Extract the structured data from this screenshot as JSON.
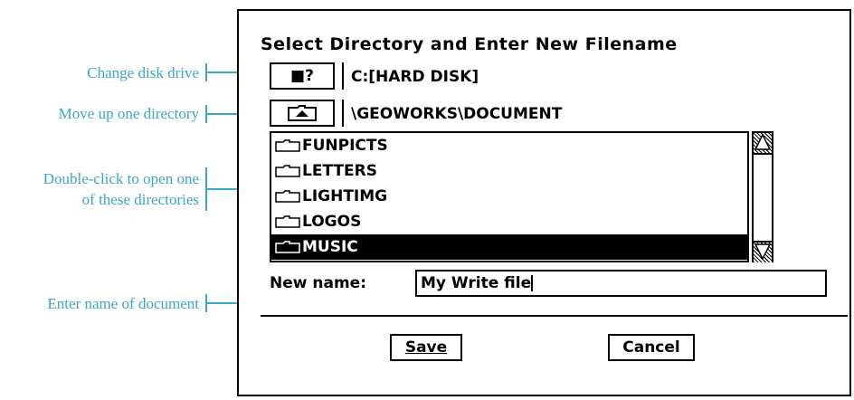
{
  "annotations": {
    "change_drive": "Change disk drive",
    "move_up": "Move up one directory",
    "open_dir_line1": "Double-click to open one",
    "open_dir_line2": "of these directories",
    "enter_name": "Enter name of document"
  },
  "dialog": {
    "title": "Select Directory and Enter New Filename",
    "drive_button_label": "■?",
    "drive_path": "C:[HARD DISK]",
    "current_path": "\\GEOWORKS\\DOCUMENT",
    "directories": [
      "FUNPICTS",
      "LETTERS",
      "LIGHTIMG",
      "LOGOS",
      "MUSIC"
    ],
    "selected_directory": "MUSIC",
    "new_name_label": "New name:",
    "new_name_value": "My Write file",
    "save_label": "Save",
    "cancel_label": "Cancel"
  }
}
